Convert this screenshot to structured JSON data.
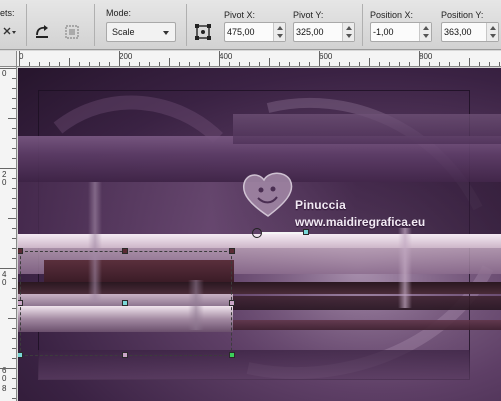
{
  "toolbar": {
    "presets_label": "ets:",
    "mode_label": "Mode:",
    "mode_value": "Scale",
    "pivot_x_label": "Pivot X:",
    "pivot_x_value": "475,00",
    "pivot_y_label": "Pivot Y:",
    "pivot_y_value": "325,00",
    "position_x_label": "Position X:",
    "position_x_value": "-1,00",
    "position_y_label": "Position Y:",
    "position_y_value": "363,00"
  },
  "ruler": {
    "h_labels": [
      "0",
      "200",
      "400",
      "600",
      "800"
    ],
    "v_labels": [
      "0",
      "2",
      "0",
      "4",
      "0",
      "6",
      "0",
      "8"
    ]
  },
  "watermark": {
    "name": "Pinuccia",
    "url": "www.maidiregrafica.eu"
  }
}
